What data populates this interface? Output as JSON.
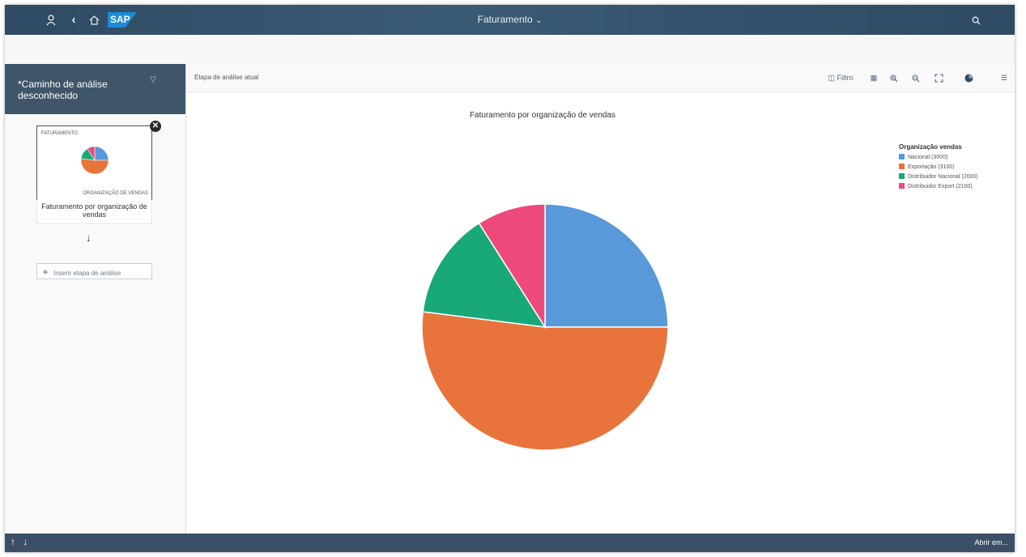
{
  "shell": {
    "title": "Faturamento",
    "icons": [
      "person-icon",
      "back-icon",
      "home-icon",
      "search-icon"
    ],
    "logo": "SAP",
    "bg_color": "#2f4b63"
  },
  "sidebar": {
    "path_title": "*Caminho de análise desconhecido",
    "card": {
      "kicker": "FATURAMENTO",
      "bottom_label": "ORGANIZAÇÃO DE VENDAS",
      "caption": "Faturamento por organização de vendas"
    },
    "insert_label": "Inserir etapa de análise"
  },
  "toolbar": {
    "label": "Etapa de análise atual",
    "filter_label": "Filtro",
    "icons": [
      "filter-icon",
      "table-icon",
      "zoom-in-icon",
      "zoom-out-icon",
      "fullscreen-icon",
      "pie-chart-icon",
      "list-icon"
    ]
  },
  "footer": {
    "right_label": "Abrir em..."
  },
  "chart_data": {
    "type": "pie",
    "title": "Faturamento por organização de vendas",
    "legend_title": "Organização vendas",
    "legend_position": "top-right",
    "categories": [
      "Nacional (3000)",
      "Exportação (3100)",
      "Distribuidor Nacional (2000)",
      "Distribuidor Export (2100)"
    ],
    "values": [
      25,
      52,
      14,
      9
    ],
    "colors": [
      "#5899da",
      "#e8743b",
      "#19a979",
      "#ed4a7b"
    ]
  }
}
